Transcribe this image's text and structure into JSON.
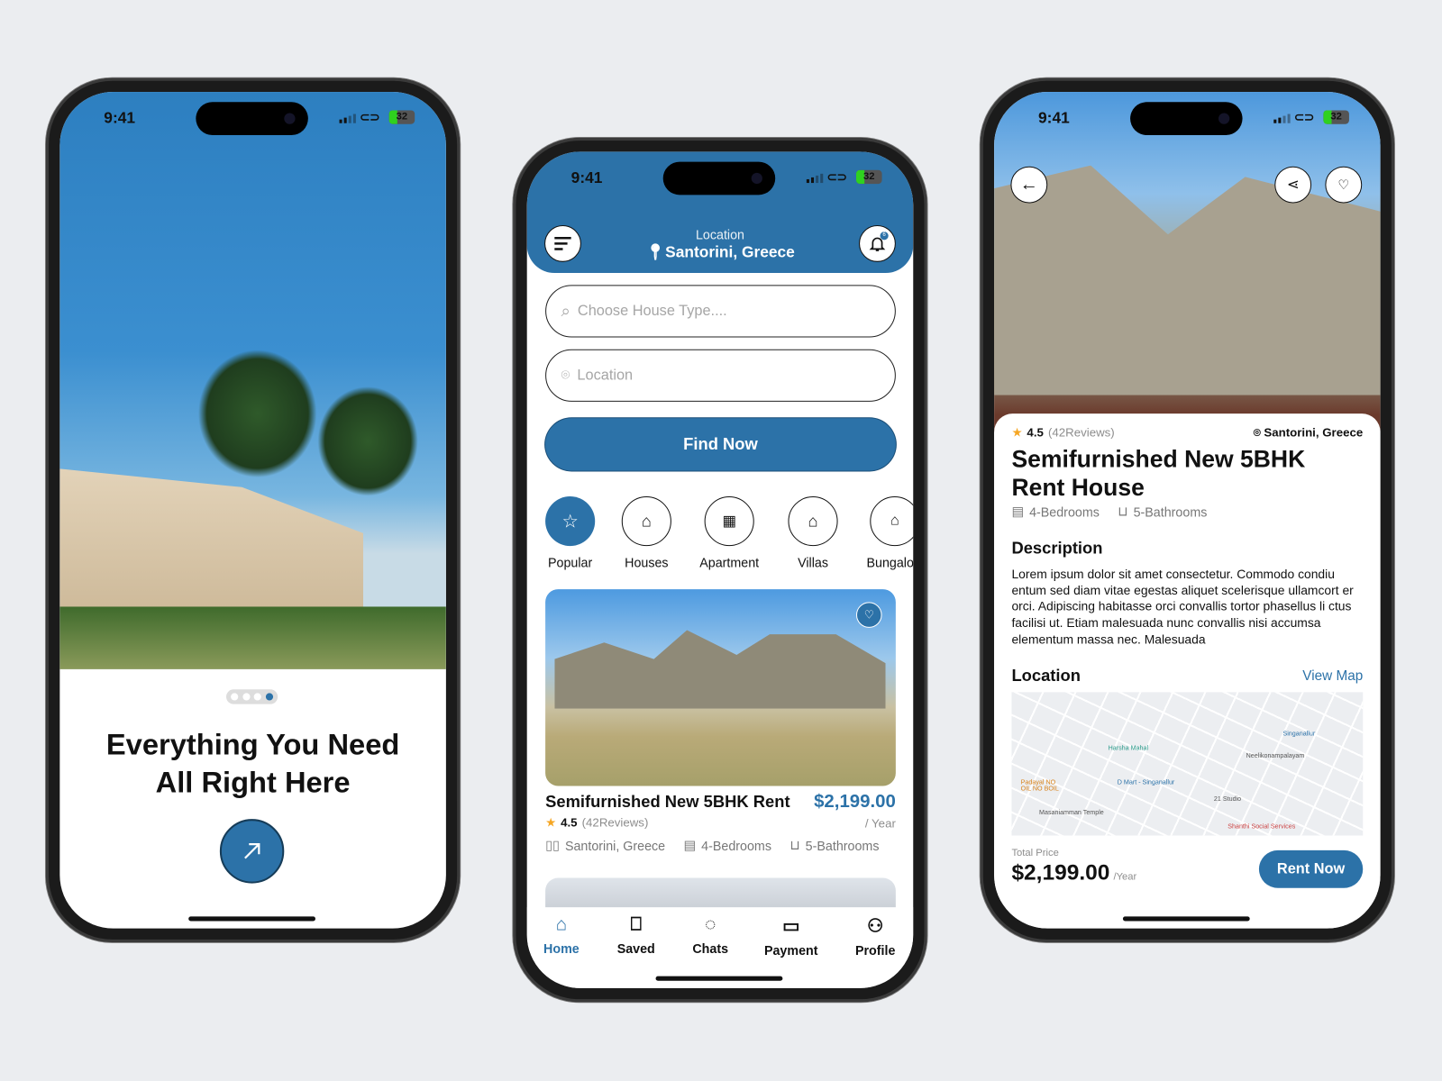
{
  "status": {
    "time": "9:41",
    "battery": "32"
  },
  "onboarding": {
    "heading_line1": "Everything You Need",
    "heading_line2": "All Right Here",
    "page_indicator": {
      "count": 4,
      "active": 4
    },
    "next_icon": "arrow-right-icon"
  },
  "home": {
    "header": {
      "location_label": "Location",
      "location_value": "Santorini, Greece",
      "menu_icon": "menu-icon",
      "notification_icon": "bell-icon",
      "notification_badge": "6"
    },
    "search_placeholder": "Choose House Type....",
    "location_placeholder": "Location",
    "find_button": "Find Now",
    "categories": [
      {
        "label": "Popular",
        "icon": "star-icon",
        "active": true
      },
      {
        "label": "Houses",
        "icon": "house-icon",
        "active": false
      },
      {
        "label": "Apartment",
        "icon": "building-icon",
        "active": false
      },
      {
        "label": "Villas",
        "icon": "villa-icon",
        "active": false
      },
      {
        "label": "Bungalow",
        "icon": "bungalow-icon",
        "active": false
      }
    ],
    "listing": {
      "title": "Semifurnished New 5BHK Rent",
      "price": "$2,199.00",
      "period": "/ Year",
      "rating": "4.5",
      "reviews": "(42Reviews)",
      "location": "Santorini, Greece",
      "bedrooms": "4-Bedrooms",
      "bathrooms": "5-Bathrooms"
    },
    "nav": [
      {
        "label": "Home",
        "icon": "home-icon",
        "active": true
      },
      {
        "label": "Saved",
        "icon": "bookmark-icon",
        "active": false
      },
      {
        "label": "Chats",
        "icon": "chat-icon",
        "active": false
      },
      {
        "label": "Payment",
        "icon": "wallet-icon",
        "active": false
      },
      {
        "label": "Profile",
        "icon": "user-icon",
        "active": false
      }
    ]
  },
  "detail": {
    "rating": "4.5",
    "reviews": "(42Reviews)",
    "location": "Santorini, Greece",
    "title_line1": "Semifurnished New 5BHK",
    "title_line2": "Rent House",
    "bedrooms": "4-Bedrooms",
    "bathrooms": "5-Bathrooms",
    "description_heading": "Description",
    "description": "Lorem ipsum dolor sit amet consectetur. Commodo condiu entum sed diam vitae egestas aliquet scelerisque ullamcort er orci. Adipiscing habitasse orci convallis tortor phasellus li ctus facilisi ut. Etiam malesuada nunc convallis nisi accumsa elementum massa nec. Malesuada",
    "location_heading": "Location",
    "view_map": "View Map",
    "map_labels": [
      "Masaniamman Temple",
      "D Mart - Singanallur",
      "Neelikonampalayam",
      "Harsha Mahal",
      "Shanthi Social Services",
      "21 Studio",
      "Singanallur",
      "Padayal NO OIL NO BOIL"
    ],
    "total_price_label": "Total Price",
    "total_price": "$2,199.00",
    "period": "/Year",
    "rent_button": "Rent Now"
  },
  "colors": {
    "primary": "#2c72a8",
    "star": "#f5a623",
    "background": "#ebedf0"
  }
}
